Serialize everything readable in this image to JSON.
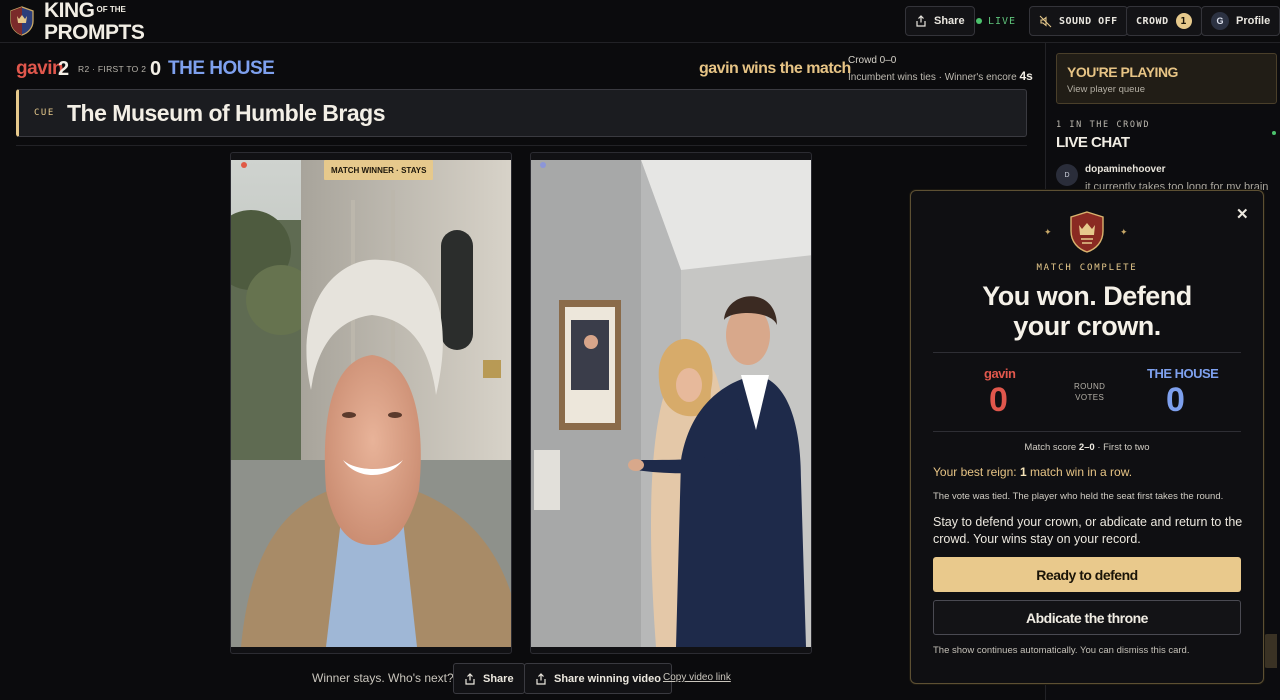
{
  "header": {
    "logo_line1": "KING",
    "logo_line1_small": "OF THE",
    "logo_line2": "PROMPTS",
    "share_label": "Share",
    "live_label": "LIVE",
    "sound_label": "SOUND OFF",
    "crowd_label": "CROWD",
    "crowd_count": "1",
    "profile_initial": "G",
    "profile_label": "Profile"
  },
  "scoreboard": {
    "player1_name": "gavin",
    "player1_score": "2",
    "round_info": "R2 · FIRST TO 2",
    "player2_score": "0",
    "player2_name": "THE HOUSE",
    "winner_text": "gavin wins the match",
    "crowd_votes": "Crowd 0–0",
    "tiebreak_text": "Incumbent wins ties · Winner's encore",
    "encore_seconds": "4s"
  },
  "cue": {
    "tag": "CUE",
    "title": "The Museum of Humble Brags"
  },
  "videos": {
    "winner_tag": "MATCH WINNER · STAYS"
  },
  "bottom": {
    "next_text": "Winner stays. Who's next?",
    "share_label": "Share",
    "share_video_label": "Share winning video",
    "copy_link_label": "Copy video link"
  },
  "sidebar": {
    "playing_title": "YOU'RE PLAYING",
    "playing_sub": "View player queue",
    "crowd_count": "1 IN THE CROWD",
    "chat_title": "LIVE CHAT",
    "chat_avatar": "D",
    "chat_user": "dopaminehoover",
    "chat_message": "it currently takes too long for my brain"
  },
  "modal": {
    "status": "MATCH COMPLETE",
    "title_line1": "You won. Defend",
    "title_line2": "your crown.",
    "p1_name": "gavin",
    "p1_votes": "0",
    "round_votes_line1": "ROUND",
    "round_votes_line2": "VOTES",
    "p2_name": "THE HOUSE",
    "p2_votes": "0",
    "match_score_prefix": "Match score",
    "match_score_value": "2–0",
    "match_score_suffix": "· First to two",
    "reign_prefix": "Your best reign:",
    "reign_value": "1",
    "reign_suffix": "match win in a row.",
    "tie_text": "The vote was tied. The player who held the seat first takes the round.",
    "stay_text": "Stay to defend your crown, or abdicate and return to the crowd. Your wins stay on your record.",
    "ready_label": "Ready to defend",
    "abdicate_label": "Abdicate the throne",
    "continues_text": "The show continues automatically. You can dismiss this card."
  },
  "colors": {
    "accent_gold": "#e6c98c",
    "player_red": "#e0574c",
    "house_blue": "#7ea0ee",
    "live_green": "#4cc36d"
  }
}
